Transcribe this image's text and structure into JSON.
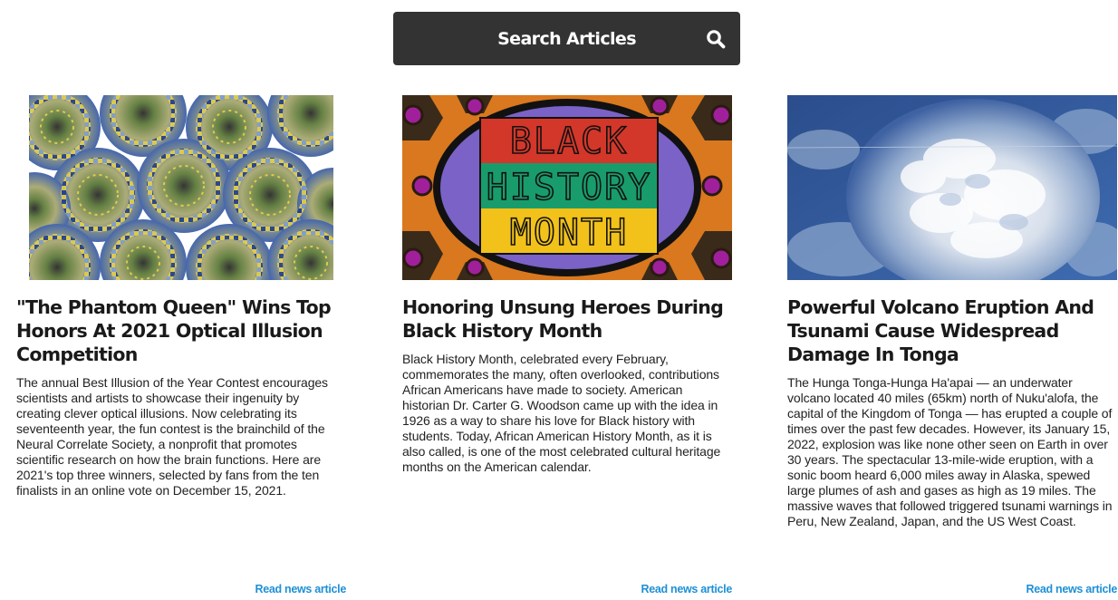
{
  "search": {
    "label": "Search Articles",
    "icon": "search-icon"
  },
  "colors": {
    "button_bg": "#333333",
    "link": "#1e90d6"
  },
  "articles": [
    {
      "image": "optical-illusion-image",
      "title": "\"The Phantom Queen\" Wins Top Honors At 2021 Optical Illusion Competition",
      "summary": "The annual Best Illusion of the Year Contest encourages scientists and artists to showcase their ingenuity by creating clever optical illusions. Now celebrating its seventeenth year, the fun contest is the brainchild of the Neural Correlate Society, a nonprofit that promotes scientific research on how the brain functions. Here are 2021's top three winners, selected by fans from the ten finalists in an online vote on December 15, 2021.",
      "link": "Read news article"
    },
    {
      "image": "black-history-month-image",
      "image_text": [
        "BLACK",
        "HISTORY",
        "MONTH"
      ],
      "title": "Honoring Unsung Heroes During Black History Month",
      "summary": "Black History Month, celebrated every February, commemorates the many, often overlooked, contributions African Americans have made to society. American historian Dr. Carter G. Woodson came up with the idea in 1926 as a way to share his love for Black history with students. Today, African American History Month, as it is also called, is one of the most celebrated cultural heritage months on the American calendar.",
      "link": "Read news article"
    },
    {
      "image": "volcano-satellite-image",
      "title": "Powerful Volcano Eruption And Tsunami Cause Widespread Damage In Tonga",
      "summary": "The Hunga Tonga-Hunga Ha'apai — an underwater volcano located 40 miles (65km) north of Nuku'alofa, the capital of the Kingdom of Tonga — has erupted a couple of times over the past few decades. However, its January 15, 2022, explosion was like none other seen on Earth in over 30 years. The spectacular 13-mile-wide eruption, with a sonic boom heard 6,000 miles away in Alaska, spewed large plumes of ash and gases as high as 19 miles. The massive waves that followed triggered tsunami warnings in Peru, New Zealand, Japan, and the US West Coast.",
      "link": "Read news article"
    }
  ]
}
